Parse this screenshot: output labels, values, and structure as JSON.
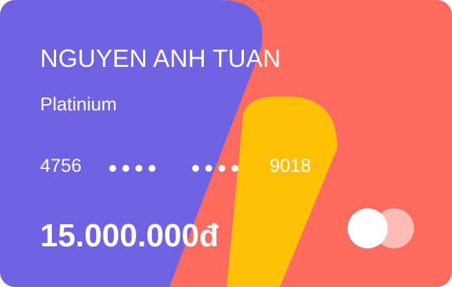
{
  "card": {
    "holder_name": "NGUYEN ANH TUAN",
    "tier": "Platinium",
    "number": {
      "first_group": "4756",
      "last_group": "9018",
      "masked_groups": 2,
      "dots_per_group": 4
    },
    "balance": "15.000.000đ",
    "brand_logo": "mastercard-style-logo-icon"
  },
  "colors": {
    "background": "#FF6B5F",
    "purple_shape": "#7063E3",
    "yellow_shape": "#FFC107",
    "text": "#FFFFFF"
  }
}
